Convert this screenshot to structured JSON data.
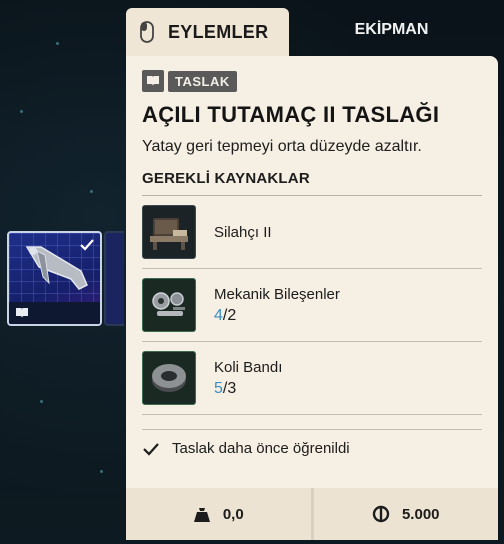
{
  "tabs": {
    "actions_label": "EYLEMLER",
    "equipment_label": "EKİPMAN",
    "actions_icon": "mouse-icon"
  },
  "item": {
    "tag": "TASLAK",
    "tag_icon": "blueprint-book-icon",
    "title": "AÇILI TUTAMAÇ II TASLAĞI",
    "description": "Yatay geri tepmeyi orta düzeyde azaltır."
  },
  "resources": {
    "heading": "GEREKLİ KAYNAKLAR",
    "items": [
      {
        "name": "Silahçı II",
        "have": "",
        "sep": "",
        "need": "",
        "icon": "workbench-icon"
      },
      {
        "name": "Mekanik Bileşenler",
        "have": "4",
        "sep": "/",
        "need": "2",
        "icon": "mechanical-parts-icon"
      },
      {
        "name": "Koli Bandı",
        "have": "5",
        "sep": "/",
        "need": "3",
        "icon": "duct-tape-icon"
      }
    ]
  },
  "status": {
    "learned_text": "Taslak daha önce öğrenildi",
    "icon": "check-icon"
  },
  "footer": {
    "weight": "0,0",
    "weight_icon": "weight-icon",
    "price": "5.000",
    "price_icon": "coin-icon"
  },
  "colors": {
    "panel_bg": "#f6efe3",
    "accent_count": "#3a8ec2",
    "background": "#0b141a"
  }
}
